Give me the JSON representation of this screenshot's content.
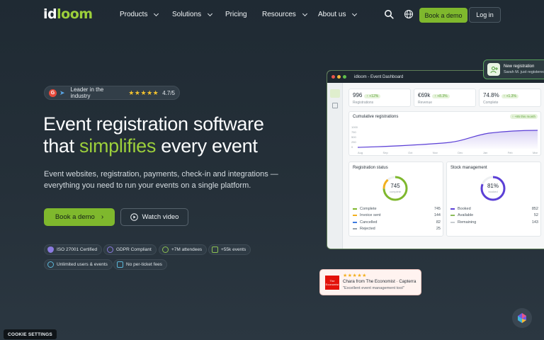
{
  "nav": {
    "logo_a": "id",
    "logo_b": "loom",
    "menu": [
      "Products",
      "Solutions",
      "Pricing",
      "Resources",
      "About us"
    ],
    "book_demo": "Book a demo",
    "login": "Log in"
  },
  "hero": {
    "rating_label": "Leader in the industry",
    "rating_stars": "★★★★★",
    "rating_value": "4.7/5",
    "title_line1": "Event registration software",
    "title_that": "that ",
    "title_accent": "simplifies",
    "title_end": " every event",
    "lead": "Event websites, registration, payments, check-in and integrations — everything you need to run your events on a single platform.",
    "cta_demo": "Book a demo",
    "cta_video": "Watch video",
    "badges": [
      "ISO 27001 Certified",
      "GDPR Compliant",
      "+7M attendees",
      "+55k events",
      "Unlimited users & events",
      "No per-ticket fees"
    ]
  },
  "dashboard": {
    "title": "idloom - Event Dashboard",
    "kpis": [
      {
        "value": "996",
        "trend": "↑ +12%",
        "label": "Registrations"
      },
      {
        "value": "€69k",
        "trend": "↑ +8.3%",
        "label": "Revenue"
      },
      {
        "value": "74.8%",
        "trend": "↑ +1.3%",
        "label": "Complete"
      }
    ],
    "cumulative_title": "Cumulative registrations",
    "cumulative_badge": "↑ +85 this month",
    "y_ticks": [
      "1000",
      "750",
      "500",
      "250",
      "0"
    ],
    "x_ticks": [
      "Aug",
      "Sep",
      "Oct",
      "Nov",
      "Dec",
      "Jan",
      "Feb",
      "Mar"
    ],
    "status_title": "Registration status",
    "status_total": "745",
    "status_total_label": "complete",
    "status_rows": [
      {
        "label": "Complete",
        "value": "745",
        "color": "#7fb82d"
      },
      {
        "label": "Invoice sent",
        "value": "144",
        "color": "#f2b01e"
      },
      {
        "label": "Cancelled",
        "value": "82",
        "color": "#3d7be0"
      },
      {
        "label": "Rejected",
        "value": "25",
        "color": "#9aa3aa"
      }
    ],
    "stock_title": "Stock management",
    "stock_pct": "81%",
    "stock_pct_label": "booked",
    "stock_rows": [
      {
        "label": "Booked",
        "value": "852",
        "color": "#5b3fd6"
      },
      {
        "label": "Available",
        "value": "52",
        "color": "#8cbc5a"
      },
      {
        "label": "Remaining",
        "value": "143",
        "color": "#c8cdd2"
      }
    ]
  },
  "toast": {
    "title": "New registration",
    "subtitle": "Sarah M. just registered"
  },
  "review": {
    "stars": "★★★★★",
    "author": "Chara from The Economist · Capterra",
    "quote": "\"Excellent event management tool\"",
    "logo_text": "The Economist"
  },
  "cookie": "COOKIE SETTINGS",
  "colors": {
    "accent": "#7fb82d",
    "bg": "#1f2a33"
  }
}
